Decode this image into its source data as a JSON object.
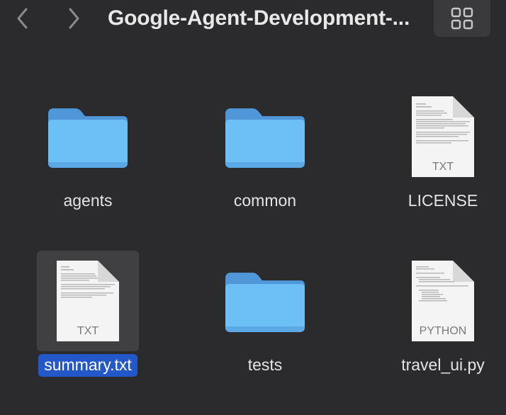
{
  "window": {
    "title": "Google-Agent-Development-...",
    "back_icon": "chevron-left-icon",
    "forward_icon": "chevron-right-icon",
    "view_icon": "grid-view-icon"
  },
  "colors": {
    "background": "#2b2b2d",
    "folder_blue": "#6cc0f5",
    "selection_blue": "#2457c8"
  },
  "items": [
    {
      "name": "agents",
      "kind": "folder",
      "type_label": ""
    },
    {
      "name": "common",
      "kind": "folder",
      "type_label": ""
    },
    {
      "name": "LICENSE",
      "kind": "document",
      "type_label": "TXT"
    },
    {
      "name": "summary.txt",
      "kind": "document",
      "type_label": "TXT",
      "selected": true
    },
    {
      "name": "tests",
      "kind": "folder",
      "type_label": ""
    },
    {
      "name": "travel_ui.py",
      "kind": "document",
      "type_label": "PYTHON"
    }
  ]
}
